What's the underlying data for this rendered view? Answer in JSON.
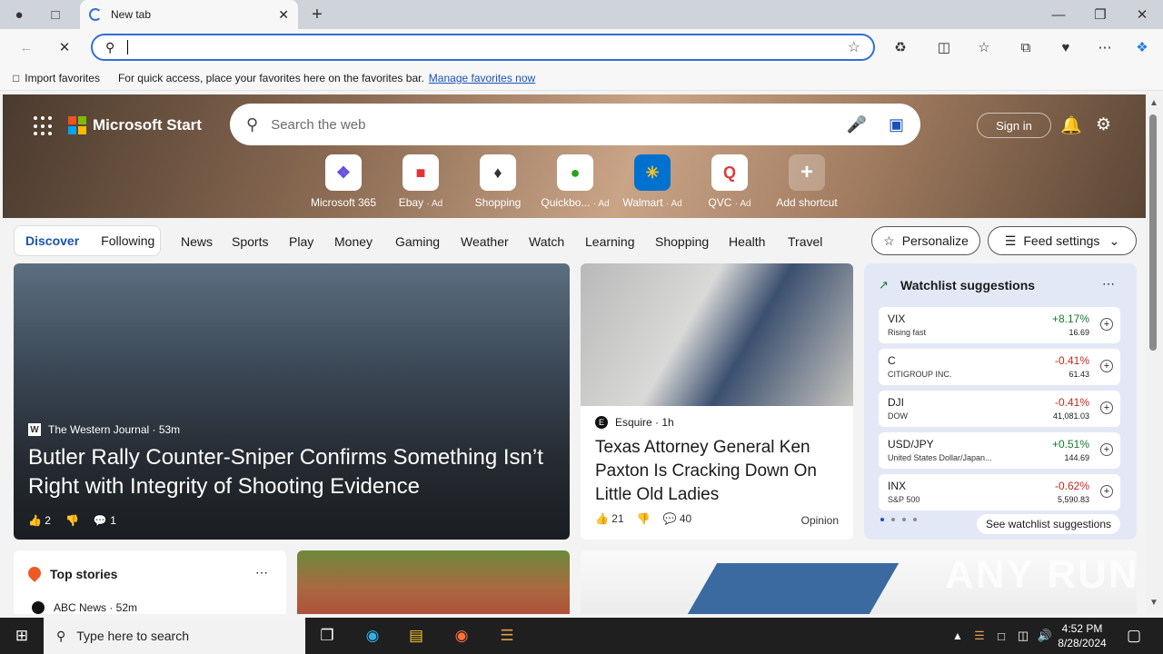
{
  "browser": {
    "tab_title": "New tab",
    "address_value": "",
    "fav_import": "Import favorites",
    "fav_hint": "For quick access, place your favorites here on the favorites bar.",
    "fav_manage": "Manage favorites now"
  },
  "header": {
    "brand": "Microsoft Start",
    "search_placeholder": "Search the web",
    "sign_in": "Sign in"
  },
  "shortcuts": [
    {
      "label": "Microsoft 365",
      "ad": ""
    },
    {
      "label": "Ebay",
      "ad": "· Ad"
    },
    {
      "label": "Shopping",
      "ad": ""
    },
    {
      "label": "Quickbo...",
      "ad": "· Ad"
    },
    {
      "label": "Walmart",
      "ad": "· Ad"
    },
    {
      "label": "QVC",
      "ad": "· Ad"
    },
    {
      "label": "Add shortcut",
      "ad": ""
    }
  ],
  "nav": {
    "discover": "Discover",
    "following": "Following",
    "links": [
      "News",
      "Sports",
      "Play",
      "Money",
      "Gaming",
      "Weather",
      "Watch",
      "Learning",
      "Shopping",
      "Health",
      "Travel"
    ],
    "personalize": "Personalize",
    "feed_settings": "Feed settings"
  },
  "main_story": {
    "source": "The Western Journal · 53m",
    "headline": "Butler Rally Counter-Sniper Confirms Something Isn’t Right with Integrity of Shooting Evidence",
    "likes": "2",
    "comments": "1"
  },
  "mid_story": {
    "source": "Esquire · 1h",
    "headline": "Texas Attorney General Ken Paxton Is Cracking Down On Little Old Ladies",
    "likes": "21",
    "comments": "40",
    "tag": "Opinion"
  },
  "watchlist": {
    "title": "Watchlist suggestions",
    "see_all": "See watchlist suggestions",
    "rows": [
      {
        "sym": "VIX",
        "name": "Rising fast",
        "chg": "+8.17%",
        "price": "16.69",
        "dir": "up"
      },
      {
        "sym": "C",
        "name": "CITIGROUP INC.",
        "chg": "-0.41%",
        "price": "61.43",
        "dir": "down"
      },
      {
        "sym": "DJI",
        "name": "DOW",
        "chg": "-0.41%",
        "price": "41,081.03",
        "dir": "down"
      },
      {
        "sym": "USD/JPY",
        "name": "United States Dollar/Japan...",
        "chg": "+0.51%",
        "price": "144.69",
        "dir": "up"
      },
      {
        "sym": "INX",
        "name": "S&P 500",
        "chg": "-0.62%",
        "price": "5,590.83",
        "dir": "down"
      }
    ]
  },
  "top_stories": {
    "title": "Top stories",
    "first_source": "ABC News · 52m"
  },
  "watermark": "ANY RUN",
  "taskbar": {
    "search_placeholder": "Type here to search",
    "time": "4:52 PM",
    "date": "8/28/2024"
  }
}
